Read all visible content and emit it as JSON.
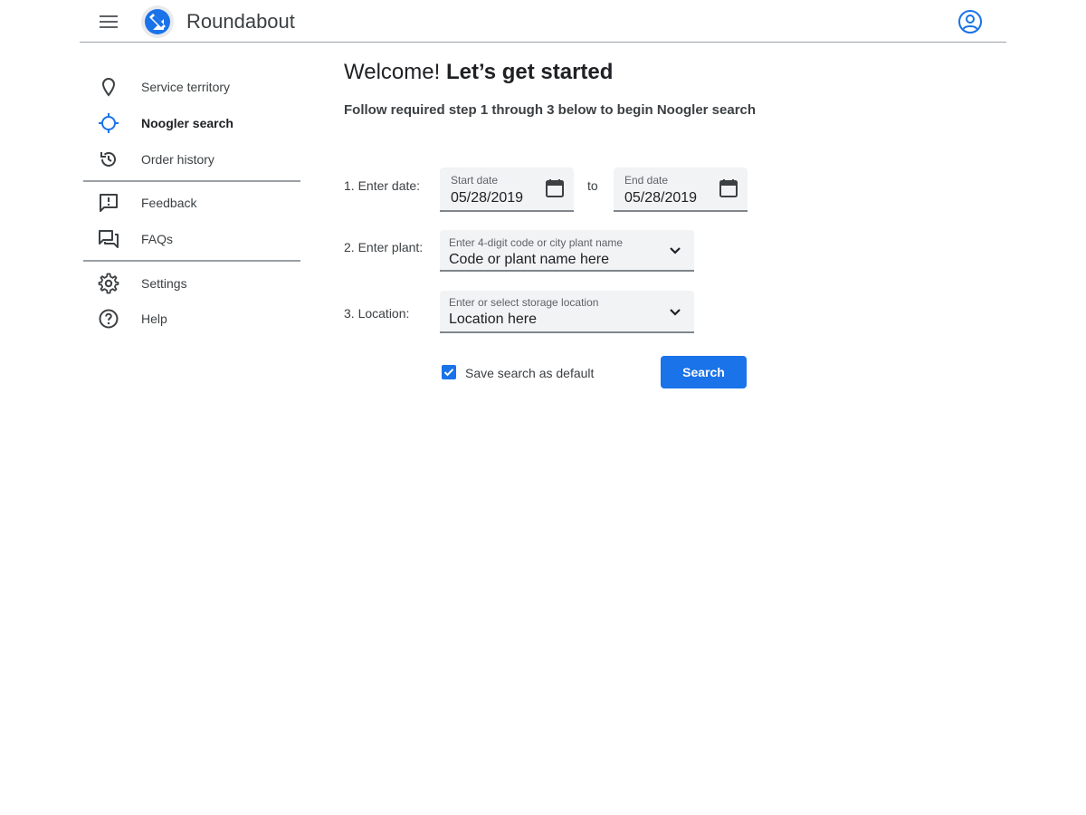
{
  "app": {
    "title": "Roundabout"
  },
  "header": {
    "menu_icon": "hamburger-menu-icon",
    "logo_icon": "roundabout-logo",
    "account_icon": "account-circle-icon"
  },
  "sidebar": {
    "items": [
      {
        "label": "Service territory",
        "icon": "location-pin-icon",
        "active": false
      },
      {
        "label": "Noogler search",
        "icon": "crosshair-icon",
        "active": true
      },
      {
        "label": "Order history",
        "icon": "history-icon",
        "active": false
      },
      {
        "label": "Feedback",
        "icon": "feedback-icon",
        "active": false
      },
      {
        "label": "FAQs",
        "icon": "forum-icon",
        "active": false
      },
      {
        "label": "Settings",
        "icon": "gear-icon",
        "active": false
      },
      {
        "label": "Help",
        "icon": "help-circle-icon",
        "active": false
      }
    ]
  },
  "main": {
    "welcome_prefix": "Welcome!",
    "welcome_bold": "Let’s get started",
    "subtitle": "Follow required step 1 through 3 below to begin Noogler search",
    "step1": {
      "label": "1. Enter date:",
      "start": {
        "label": "Start date",
        "value": "05/28/2019"
      },
      "to": "to",
      "end": {
        "label": "End date",
        "value": "05/28/2019"
      }
    },
    "step2": {
      "label": "2. Enter plant:",
      "field_label": "Enter 4-digit code or city plant name",
      "placeholder": "Code or plant name here"
    },
    "step3": {
      "label": "3. Location:",
      "field_label": "Enter or select storage location",
      "placeholder": "Location here"
    },
    "save_default": {
      "label": "Save search as default",
      "checked": true
    },
    "search_button": "Search"
  },
  "colors": {
    "accent": "#1a73e8",
    "text": "#202124",
    "field_bg": "#f1f3f4",
    "divider": "#9aa0a6"
  }
}
